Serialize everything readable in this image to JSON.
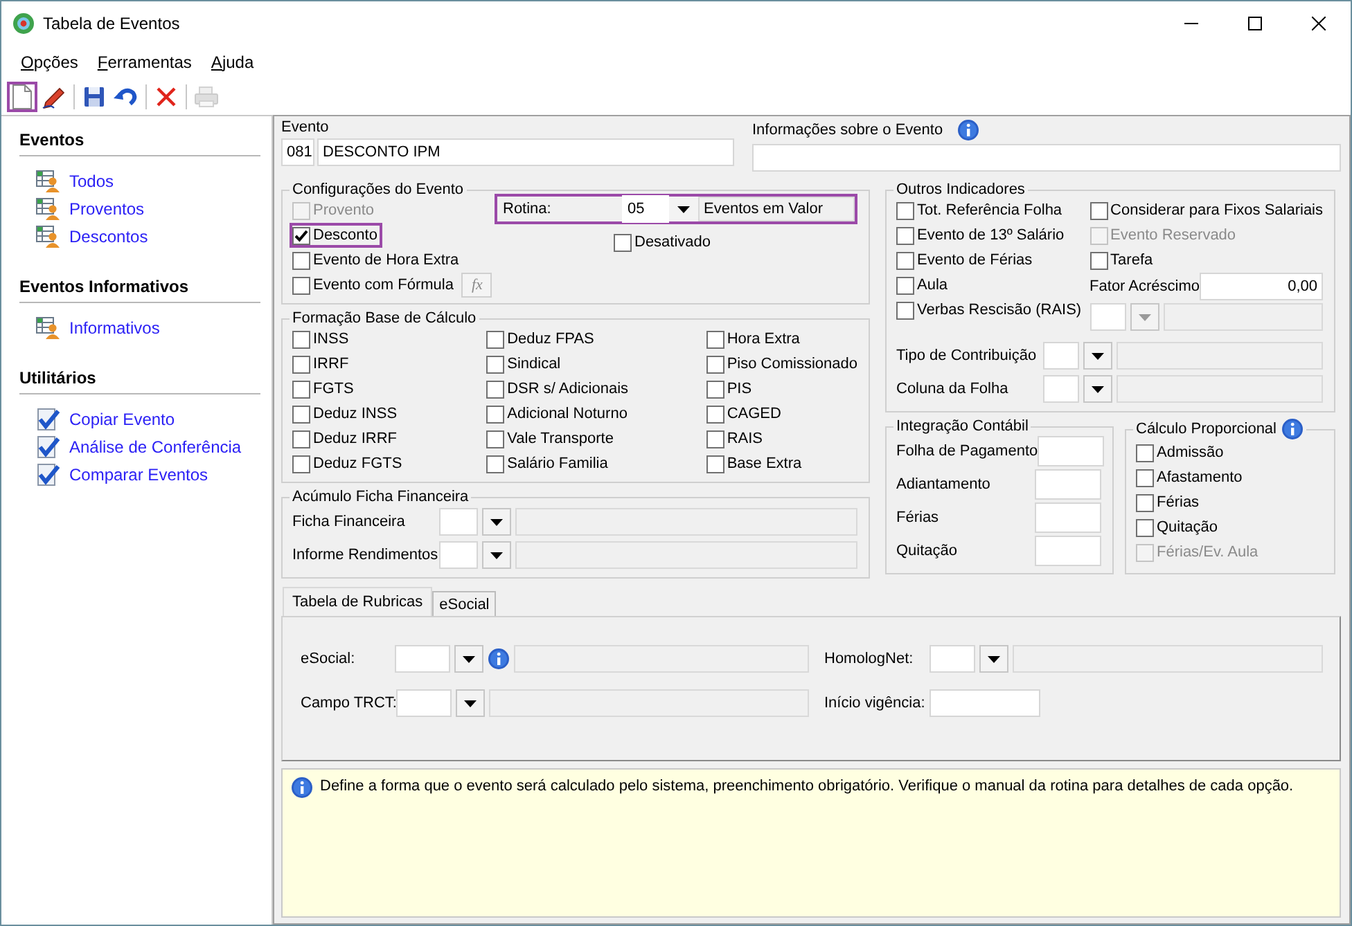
{
  "window": {
    "title": "Tabela de Eventos"
  },
  "menu": [
    {
      "label": "Opções"
    },
    {
      "label": "Ferramentas"
    },
    {
      "label": "Ajuda"
    }
  ],
  "toolbar": [
    {
      "kind": "new",
      "highlighted": true,
      "disabled": false
    },
    {
      "kind": "edit",
      "highlighted": false,
      "disabled": false
    },
    {
      "kind": "separator"
    },
    {
      "kind": "save",
      "highlighted": false,
      "disabled": false
    },
    {
      "kind": "undo",
      "highlighted": false,
      "disabled": false
    },
    {
      "kind": "separator"
    },
    {
      "kind": "delete",
      "highlighted": false,
      "disabled": false
    },
    {
      "kind": "separator"
    },
    {
      "kind": "print",
      "highlighted": false,
      "disabled": true
    }
  ],
  "sidebar": [
    {
      "title": "Eventos",
      "items": [
        {
          "label": "Todos",
          "kind": "table"
        },
        {
          "label": "Proventos",
          "kind": "table"
        },
        {
          "label": "Descontos",
          "kind": "table"
        }
      ]
    },
    {
      "title": "Eventos Informativos",
      "items": [
        {
          "label": "Informativos",
          "kind": "table"
        }
      ]
    },
    {
      "title": "Utilitários",
      "items": [
        {
          "label": "Copiar Evento",
          "kind": "check"
        },
        {
          "label": "Análise de Conferência",
          "kind": "check"
        },
        {
          "label": "Comparar Eventos",
          "kind": "check"
        }
      ]
    }
  ],
  "evento": {
    "label": "Evento",
    "code": "081",
    "name": "DESCONTO IPM"
  },
  "info": {
    "label": "Informações sobre o Evento"
  },
  "config": {
    "title": "Configurações do Evento",
    "formula_button": "fx",
    "checkboxes": [
      {
        "label": "Provento",
        "checked": false,
        "disabled": true,
        "highlighted": false
      },
      {
        "label": "Desconto",
        "checked": true,
        "disabled": false,
        "highlighted": true
      },
      {
        "label": "Evento de Hora Extra",
        "checked": false,
        "disabled": false,
        "highlighted": false
      },
      {
        "label": "Evento com Fórmula",
        "checked": false,
        "disabled": false,
        "highlighted": false
      }
    ],
    "rotina": {
      "label": "Rotina:",
      "code": "05",
      "description": "Eventos em Valor",
      "highlighted": true
    },
    "desativado": {
      "label": "Desativado",
      "checked": false
    }
  },
  "base": {
    "title": "Formação Base de Cálculo",
    "columns": [
      [
        {
          "label": "INSS",
          "checked": false
        },
        {
          "label": "IRRF",
          "checked": false
        },
        {
          "label": "FGTS",
          "checked": false
        },
        {
          "label": "Deduz INSS",
          "checked": false
        },
        {
          "label": "Deduz IRRF",
          "checked": false
        },
        {
          "label": "Deduz FGTS",
          "checked": false
        }
      ],
      [
        {
          "label": "Deduz FPAS",
          "checked": false
        },
        {
          "label": "Sindical",
          "checked": false
        },
        {
          "label": "DSR s/ Adicionais",
          "checked": false
        },
        {
          "label": "Adicional Noturno",
          "checked": false
        },
        {
          "label": "Vale Transporte",
          "checked": false
        },
        {
          "label": "Salário Familia",
          "checked": false
        }
      ],
      [
        {
          "label": "Hora Extra",
          "checked": false
        },
        {
          "label": "Piso Comissionado",
          "checked": false
        },
        {
          "label": "PIS",
          "checked": false
        },
        {
          "label": "CAGED",
          "checked": false
        },
        {
          "label": "RAIS",
          "checked": false
        },
        {
          "label": "Base Extra",
          "checked": false
        }
      ]
    ]
  },
  "acumulo": {
    "title": "Acúmulo Ficha Financeira",
    "rows": [
      {
        "label": "Ficha Financeira"
      },
      {
        "label": "Informe Rendimentos"
      }
    ]
  },
  "outros": {
    "title": "Outros Indicadores",
    "left": [
      {
        "label": "Tot. Referência Folha",
        "checked": false,
        "disabled": false
      },
      {
        "label": "Evento de 13º Salário",
        "checked": false,
        "disabled": false
      },
      {
        "label": "Evento de Férias",
        "checked": false,
        "disabled": false
      },
      {
        "label": "Aula",
        "checked": false,
        "disabled": false
      },
      {
        "label": "Verbas Rescisão (RAIS)",
        "checked": false,
        "disabled": false
      }
    ],
    "right": [
      {
        "label": "Considerar para Fixos Salariais",
        "checked": false,
        "disabled": false
      },
      {
        "label": "Evento Reservado",
        "checked": false,
        "disabled": true
      },
      {
        "label": "Tarefa",
        "checked": false,
        "disabled": false
      }
    ],
    "fator": {
      "label": "Fator Acréscimo",
      "value": "0,00"
    },
    "side_combo": {
      "disabled": true
    },
    "combos": [
      {
        "label": "Tipo de Contribuição"
      },
      {
        "label": "Coluna da Folha"
      }
    ]
  },
  "integracao": {
    "title": "Integração Contábil",
    "fields": [
      {
        "label": "Folha de Pagamento"
      },
      {
        "label": "Adiantamento"
      },
      {
        "label": "Férias"
      },
      {
        "label": "Quitação"
      }
    ]
  },
  "proporcional": {
    "title": "Cálculo Proporcional",
    "checkboxes": [
      {
        "label": "Admissão",
        "checked": false,
        "disabled": false
      },
      {
        "label": "Afastamento",
        "checked": false,
        "disabled": false
      },
      {
        "label": "Férias",
        "checked": false,
        "disabled": false
      },
      {
        "label": "Quitação",
        "checked": false,
        "disabled": false
      },
      {
        "label": "Férias/Ev. Aula",
        "checked": false,
        "disabled": true
      }
    ]
  },
  "tabs": [
    {
      "label": "Tabela de Rubricas",
      "selected": true
    },
    {
      "label": "eSocial",
      "selected": false
    }
  ],
  "rubricas": {
    "left": [
      {
        "label": "eSocial:",
        "info": true
      },
      {
        "label": "Campo TRCT:",
        "info": false
      }
    ],
    "right": [
      {
        "label": "HomologNet:",
        "kind": "combo"
      },
      {
        "label": "Início vigência:",
        "kind": "date"
      }
    ]
  },
  "hint": "Define a forma que o evento será calculado pelo sistema, preenchimento obrigatório. Verifique o manual da rotina para detalhes de cada opção."
}
